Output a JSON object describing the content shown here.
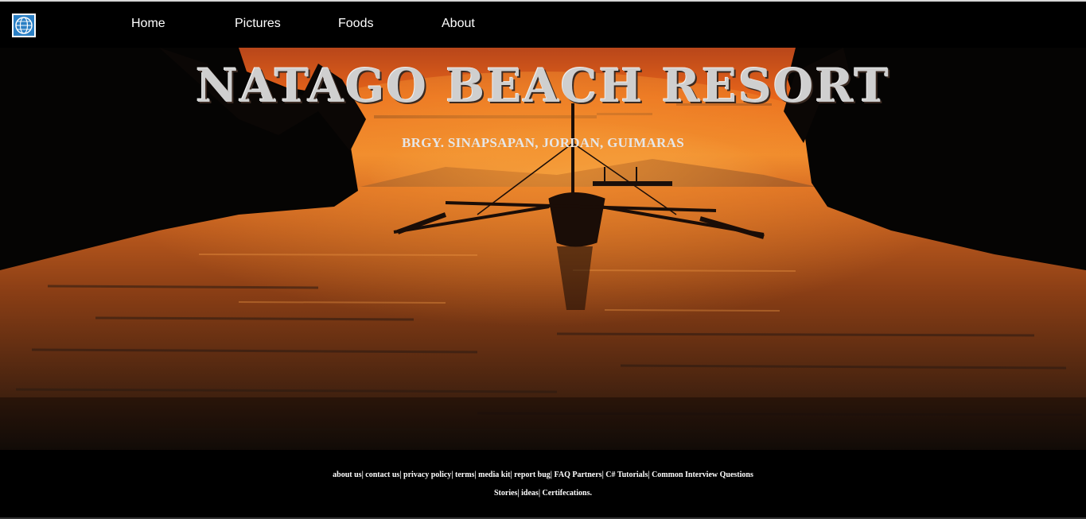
{
  "nav": {
    "logo_icon": "globe-icon",
    "items": [
      {
        "label": "Home"
      },
      {
        "label": "Pictures"
      },
      {
        "label": "Foods"
      },
      {
        "label": "About"
      }
    ]
  },
  "hero": {
    "title": "NATAGO BEACH RESORT",
    "subtitle": "BRGY. SINAPSAPAN, JORDAN, GUIMARAS"
  },
  "footer": {
    "row1": [
      {
        "label": "about us"
      },
      {
        "label": "contact us"
      },
      {
        "label": "privacy policy"
      },
      {
        "label": "terms"
      },
      {
        "label": "media kit"
      },
      {
        "label": "report bug"
      },
      {
        "label": "FAQ Partners"
      },
      {
        "label": "C# Tutorials"
      },
      {
        "label": "Common Interview Questions"
      }
    ],
    "row2": [
      {
        "label": "Stories"
      },
      {
        "label": "ideas"
      },
      {
        "label": "Certifecations."
      }
    ],
    "separator": "| "
  },
  "colors": {
    "background": "#000000",
    "nav_text": "#ffffff",
    "title_text": "#cfcfcf",
    "sunset_orange": "#e8651a"
  }
}
